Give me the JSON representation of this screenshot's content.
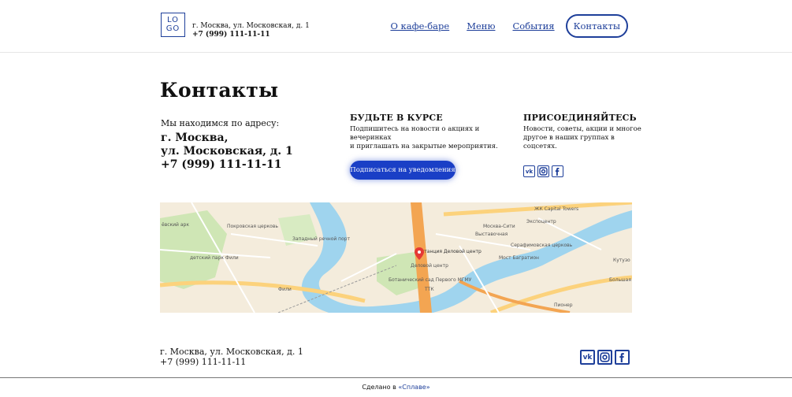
{
  "header": {
    "logo_line1": "LO",
    "logo_line2": "GO",
    "address": "г. Москва, ул. Московская, д. 1",
    "phone": "+7 (999) 111-11-11"
  },
  "nav": {
    "items": [
      "О кафе-баре",
      "Меню",
      "События"
    ],
    "active": "Контакты"
  },
  "page": {
    "title": "Контакты"
  },
  "address_block": {
    "intro": "Мы находимся по адресу:",
    "city": "г. Москва,",
    "street": "ул. Московская, д. 1",
    "phone": "+7 (999) 111-11-11"
  },
  "subscribe": {
    "title": "БУДЬТЕ В КУРСЕ",
    "text_line1": "Подпишитесь на новости о акциях и вечеринках",
    "text_line2": "и приглашать на закрытые мероприятия.",
    "button": "Подписаться на уведомления"
  },
  "join": {
    "title": "ПРИСОЕДИНЯЙТЕСЬ",
    "text_line1": "Новости, советы, акции и многое",
    "text_line2": "другое в наших группах в соцсетях.",
    "vk": "vk",
    "icons": [
      "vk-icon",
      "instagram-icon",
      "facebook-icon"
    ]
  },
  "map": {
    "labels": {
      "park": "ёвский арк",
      "pokrov": "Покровская церковь",
      "port": "Западный речной порт",
      "park2": "детский парк Фили",
      "station": "станция Деловой центр",
      "center": "Деловой центр",
      "garden": "Ботанический сад Первого МГМУ",
      "moscow_city": "Москва-Сити",
      "vystavochnaya": "Выставочная",
      "bagration": "Мост Багратион",
      "kutuz": "Кутузо",
      "bolshaya": "Большая",
      "fili": "Фили",
      "ttk": "ТТК",
      "capital": "ЖК Capital Towers",
      "ekspocentr": "Экспоцентр",
      "serafim": "Серафимовская церковь",
      "pioneer": "Пионер"
    }
  },
  "footer": {
    "address": "г. Москва, ул. Московская, д. 1",
    "phone": "+7 (999) 111-11-11",
    "made_prefix": "Сделано в ",
    "made_link": "«Сплаве»"
  },
  "colors": {
    "accent": "#1e3f9a",
    "button": "#1a3fc6"
  }
}
